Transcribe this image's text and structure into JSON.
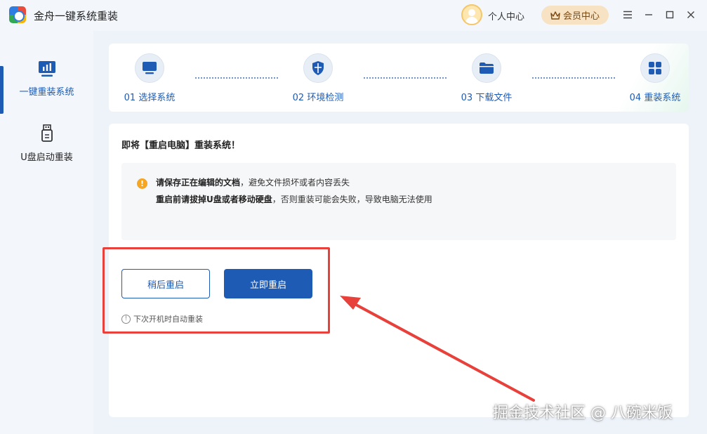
{
  "window": {
    "title": "金舟一键系统重装",
    "user_center_label": "个人中心",
    "vip_label": "会员中心",
    "controls": [
      "menu-icon",
      "minimize-icon",
      "maximize-icon",
      "close-icon"
    ]
  },
  "sidebar": {
    "items": [
      {
        "label": "一键重装系统",
        "icon": "monitor-chart-icon",
        "active": true
      },
      {
        "label": "U盘启动重装",
        "icon": "usb-drive-icon",
        "active": false
      }
    ]
  },
  "steps": [
    {
      "label": "01 选择系统",
      "icon": "monitor-icon"
    },
    {
      "label": "02 环境检测",
      "icon": "shield-icon"
    },
    {
      "label": "03 下载文件",
      "icon": "folder-icon"
    },
    {
      "label": "04 重装系统",
      "icon": "grid-icon"
    }
  ],
  "main": {
    "title": "即将【重启电脑】重装系统！",
    "notice": {
      "line1_bold": "请保存正在编辑的文档",
      "line1_rest": "，避免文件损坏或者内容丢失",
      "line2_bold": "重启前请拔掉U盘或者移动硬盘",
      "line2_rest": "，否则重装可能会失败，导致电脑无法使用"
    },
    "later_button": "稍后重启",
    "now_button": "立即重启",
    "auto_note": "下次开机时自动重装"
  },
  "watermark": "掘金技术社区 @ 八碗米饭",
  "colors": {
    "accent": "#1d5bb5",
    "warning": "#f5a623",
    "annotation_red": "#e8403a",
    "vip_bg": "#f7e2c4"
  }
}
